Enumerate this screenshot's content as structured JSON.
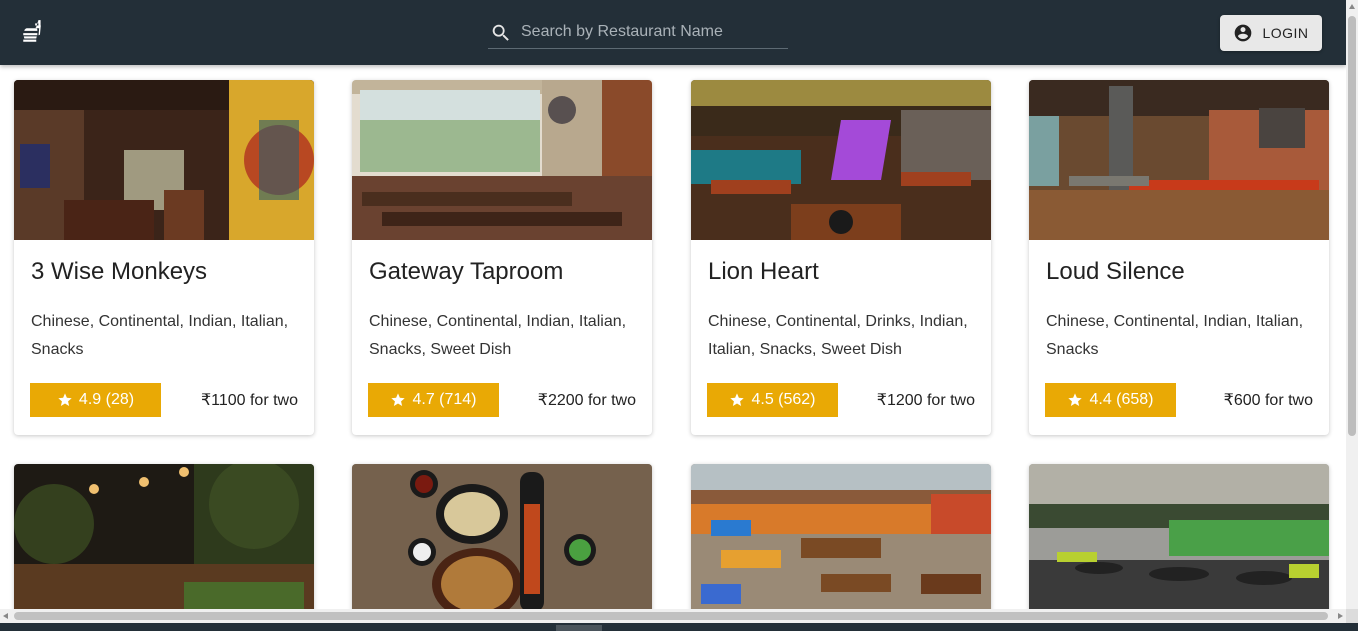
{
  "header": {
    "logo_icon": "fastfood-icon",
    "search": {
      "placeholder": "Search by Restaurant Name",
      "value": "",
      "icon": "search-icon"
    },
    "login": {
      "label": "LOGIN",
      "icon": "account-circle-icon"
    }
  },
  "colors": {
    "header_bg": "#232f38",
    "rating_bg": "#e9a905",
    "login_bg": "#e8e8e8"
  },
  "restaurants": [
    {
      "name": "3 Wise Monkeys",
      "cuisines": "Chinese, Continental, Indian, Italian, Snacks",
      "rating": "4.9 (28)",
      "cost": "₹1100 for two"
    },
    {
      "name": "Gateway Taproom",
      "cuisines": "Chinese, Continental, Indian, Italian, Snacks, Sweet Dish",
      "rating": "4.7 (714)",
      "cost": "₹2200 for two"
    },
    {
      "name": "Lion Heart",
      "cuisines": "Chinese, Continental, Drinks, Indian, Italian, Snacks, Sweet Dish",
      "rating": "4.5 (562)",
      "cost": "₹1200 for two"
    },
    {
      "name": "Loud Silence",
      "cuisines": "Chinese, Continental, Indian, Italian, Snacks",
      "rating": "4.4 (658)",
      "cost": "₹600 for two"
    }
  ]
}
